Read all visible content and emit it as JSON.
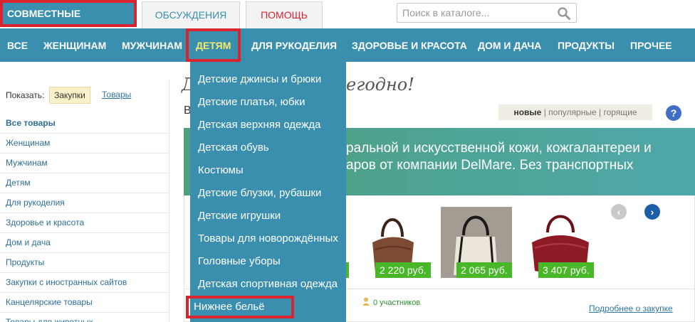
{
  "header": {
    "brand": "СОВМЕСТНЫЕ ПОКУПКИ:",
    "tab_discussions": "ОБСУЖДЕНИЯ",
    "tab_help": "ПОМОЩЬ",
    "search_placeholder": "Поиск в каталоге..."
  },
  "nav": {
    "items": [
      {
        "label": "ВСЕ"
      },
      {
        "label": "ЖЕНЩИНАМ"
      },
      {
        "label": "МУЖЧИНАМ"
      },
      {
        "label": "ДЕТЯМ"
      },
      {
        "label": "ДЛЯ РУКОДЕЛИЯ"
      },
      {
        "label": "ЗДОРОВЬЕ И КРАСОТА"
      },
      {
        "label": "ДОМ И ДАЧА"
      },
      {
        "label": "ПРОДУКТЫ"
      },
      {
        "label": "ПРОЧЕЕ"
      }
    ]
  },
  "dropdown": {
    "items": [
      "Детские джинсы и брюки",
      "Детские платья, юбки",
      "Детская верхняя одежда",
      "Детская обувь",
      "Костюмы",
      "Детские блузки, рубашки",
      "Детские игрушки",
      "Товары для новорождённых",
      "Головные уборы",
      "Детская спортивная одежда",
      "Нижнее бельё"
    ]
  },
  "sidebar": {
    "show_label": "Показать:",
    "show_active": "Закупки",
    "show_other": "Товары",
    "categories": [
      "Все товары",
      "Женщинам",
      "Мужчинам",
      "Детям",
      "Для рукоделия",
      "Здоровье и красота",
      "Дом и дача",
      "Продукты",
      "Закупки с иностранных сайтов",
      "Канцелярские товары",
      "Товары для животных"
    ]
  },
  "main": {
    "title_left": "Д",
    "title_right": "егодно!",
    "subtitle": "В",
    "sort_new": "новые",
    "sort_popular": "популярные",
    "sort_hot": "горящие",
    "help": "?",
    "promo_line1": "ральной и искусственной кожи, кожгалантереи и",
    "promo_line2": "аров от компании DelMare. Без транспортных",
    "prices": [
      "2 220 руб.",
      "2 065 руб.",
      "3 407 руб."
    ],
    "participants": "0 участников",
    "more_link": "Подробнее о закупке"
  },
  "colors": {
    "accent": "#3a8fae",
    "highlight_border": "#d9232e",
    "price_green": "#48b828"
  }
}
